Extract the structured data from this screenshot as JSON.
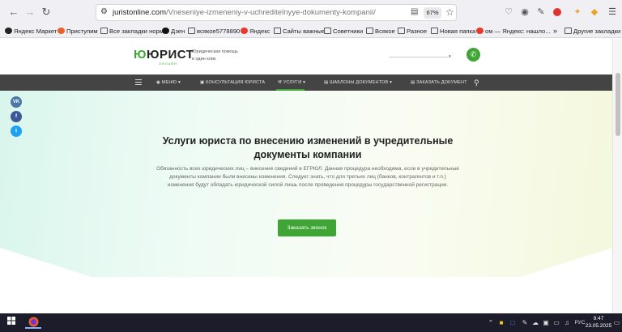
{
  "browser": {
    "url_domain": "juristonline.com",
    "url_path": "/Vneseniye-izmeneniy-v-uchreditelnyye-dokumenty-kompanii/",
    "zoom": "67%"
  },
  "bookmarks": [
    "Яндекс Маркет",
    "Приступим",
    "Все закладки норм",
    "Дзен",
    "всякое5778890",
    "Яндекс",
    "Сайты важные",
    "Советники",
    "Всякое",
    "Разное",
    "Новая папка",
    "ом — Яндекс: нашло...",
    "Другие закладки"
  ],
  "site": {
    "logo_mark": "Ю",
    "logo_word": "ЮРИСТ",
    "logo_sub": "ОНЛАЙН",
    "tagline_1": "Юридическая помощь",
    "tagline_2": "в один клик",
    "nav": {
      "menu": "МЕНЮ",
      "consult": "КОНСУЛЬТАЦИЯ ЮРИСТА",
      "services": "УСЛУГИ",
      "templates": "ШАБЛОНЫ ДОКУМЕНТОВ",
      "order": "ЗАКАЗАТЬ ДОКУМЕНТ"
    },
    "social": [
      "VK",
      "f",
      "t"
    ]
  },
  "hero": {
    "title_1": "Услуги юриста по внесению изменений в учредительные",
    "title_2": "документы компании",
    "text_1": "Обязанность всех юридических лиц – внесение сведений в ЕГРЮЛ. Данная процедура необходима, если в учредительные",
    "text_2": "документы компании были внесены изменения. Следует знать, что для третьих лиц (банков, контрагентов и т.п.)",
    "text_3": "изменения будут обладать юридической силой лишь после проведения процедуры государственной регистрации.",
    "cta": "Заказать звонок"
  },
  "taskbar": {
    "lang": "РУС",
    "time": "9:47",
    "date": "23.05.2025"
  },
  "colors": {
    "brand_green": "#3fa535",
    "nav_bg": "#444444",
    "taskbar_bg": "#1c1c2b"
  }
}
